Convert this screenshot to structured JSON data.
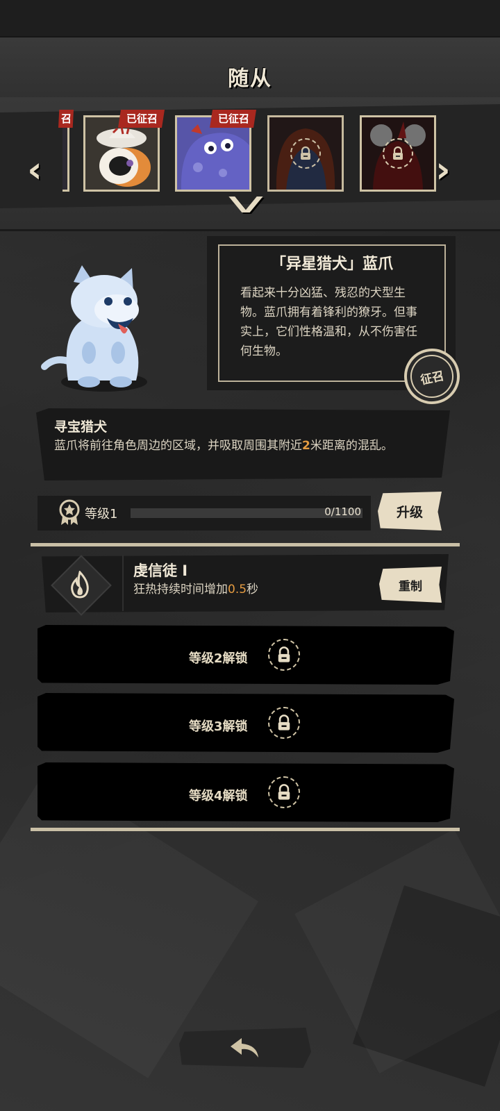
{
  "header": {
    "title": "随从"
  },
  "carousel": {
    "prev_icon": "chevron-left-icon",
    "next_icon": "chevron-right-icon",
    "expand_icon": "chevron-down-icon",
    "partial_badge": "召",
    "slots": [
      {
        "name": "cat-companion",
        "status": "已征召",
        "locked": false
      },
      {
        "name": "blue-creature",
        "status": "已征召",
        "locked": false
      },
      {
        "name": "red-haired-companion",
        "status": "",
        "locked": true
      },
      {
        "name": "horned-companion",
        "status": "",
        "locked": true
      }
    ]
  },
  "companion": {
    "title": "「异星猎犬」蓝爪",
    "description": "看起来十分凶猛、残忍的犬型生物。蓝爪拥有着锋利的獠牙。但事实上，它们性格温和，从不伤害任何生物。",
    "stamp_label": "征召"
  },
  "skill": {
    "name": "寻宝猎犬",
    "desc_part1": "蓝爪将前往角色周边的区域，并吸取周围其附近",
    "desc_highlight": "2",
    "desc_part2": "米距离的混乱。"
  },
  "level": {
    "label": "等级1",
    "xp_text": "0/1100",
    "xp_progress": 0,
    "upgrade_label": "升级",
    "icon": "medal-icon"
  },
  "traits": [
    {
      "name": "虔信徒 I",
      "desc_part1": "狂热持续时间增加",
      "desc_highlight": "0.5",
      "desc_part2": "秒",
      "icon": "flame-icon",
      "action_label": "重制"
    }
  ],
  "locked_traits": [
    {
      "label": "等级2解锁",
      "icon": "lock-icon"
    },
    {
      "label": "等级3解锁",
      "icon": "lock-icon"
    },
    {
      "label": "等级4解锁",
      "icon": "lock-icon"
    }
  ],
  "footer": {
    "back_icon": "back-arrow-icon"
  },
  "colors": {
    "accent": "#e49b41",
    "badge": "#a9281f",
    "parchment": "#e7dcc4"
  }
}
